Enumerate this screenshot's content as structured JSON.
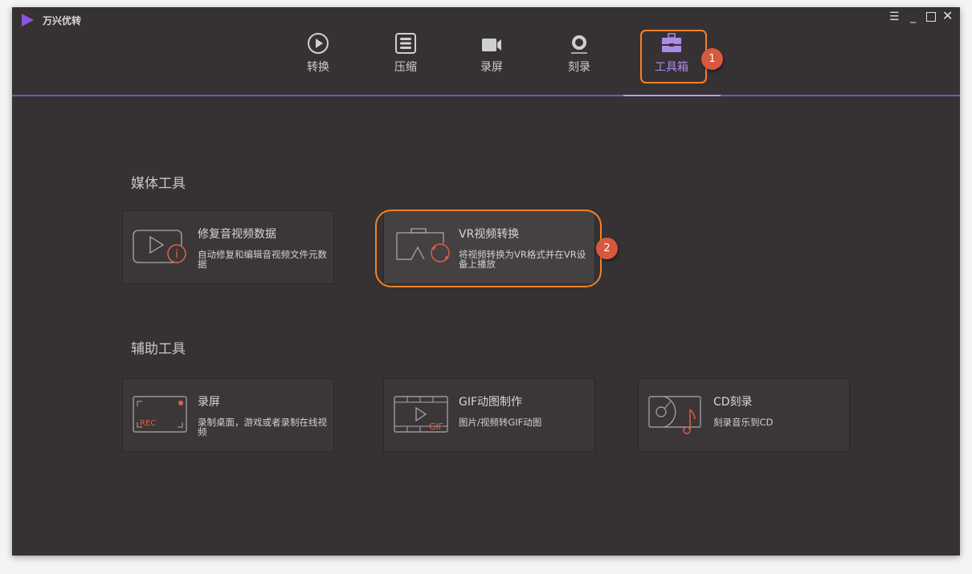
{
  "app": {
    "title": "万兴优转"
  },
  "window_controls": [
    "menu-icon",
    "minimize-icon",
    "maximize-icon",
    "close-icon"
  ],
  "nav": [
    {
      "label": "转换",
      "icon": "convert-icon"
    },
    {
      "label": "压缩",
      "icon": "compress-icon"
    },
    {
      "label": "录屏",
      "icon": "record-icon"
    },
    {
      "label": "刻录",
      "icon": "burn-icon"
    },
    {
      "label": "工具箱",
      "icon": "toolbox-icon",
      "active": true
    }
  ],
  "badges": {
    "one": "1",
    "two": "2"
  },
  "sections": {
    "media": {
      "title": "媒体工具",
      "cards": [
        {
          "title": "修复音视频数据",
          "desc": "自动修复和编辑音视频文件元数据"
        },
        {
          "title": "VR视频转换",
          "desc": "将视频转换为VR格式并在VR设备上播放"
        }
      ]
    },
    "aux": {
      "title": "辅助工具",
      "cards": [
        {
          "title": "录屏",
          "desc": "录制桌面，游戏或者录制在线视频",
          "icon_text": "REC"
        },
        {
          "title": "GIF动图制作",
          "desc": "图片/视频转GIF动图",
          "icon_text": "GIF"
        },
        {
          "title": "CD刻录",
          "desc": "刻录音乐到CD"
        }
      ]
    }
  },
  "colors": {
    "accent": "#7b4fc9",
    "highlight": "#f0822a",
    "badge": "#d8583f"
  }
}
